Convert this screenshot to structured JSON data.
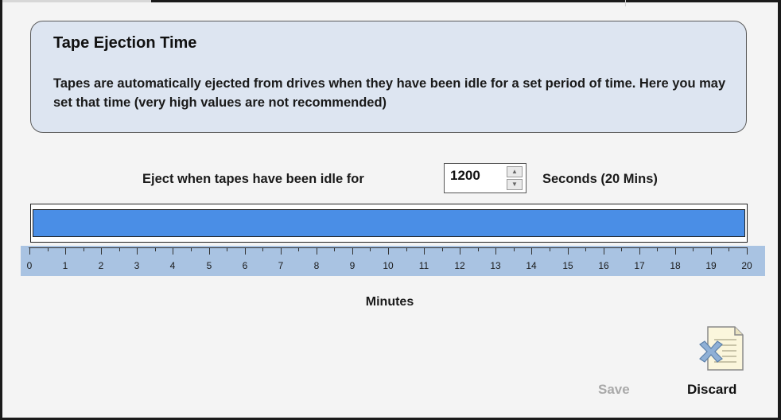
{
  "info": {
    "title": "Tape Ejection Time",
    "body": "Tapes are automatically ejected from drives when they have been idle for a set period of time. Here you may set that time (very high values are not recommended)"
  },
  "eject": {
    "label": "Eject when tapes have been idle for",
    "value": "1200",
    "unit_label": "Seconds (20 Mins)"
  },
  "slider": {
    "min": 0,
    "max": 20,
    "value_minutes": 20,
    "tick_labels": [
      "0",
      "1",
      "2",
      "3",
      "4",
      "5",
      "6",
      "7",
      "8",
      "9",
      "10",
      "11",
      "12",
      "13",
      "14",
      "15",
      "16",
      "17",
      "18",
      "19",
      "20"
    ],
    "axis_label": "Minutes",
    "fill_color": "#4a8ee6",
    "scale_color": "#a9c3e2"
  },
  "actions": {
    "save_label": "Save",
    "discard_label": "Discard",
    "discard_icon": "discard-document-icon"
  }
}
